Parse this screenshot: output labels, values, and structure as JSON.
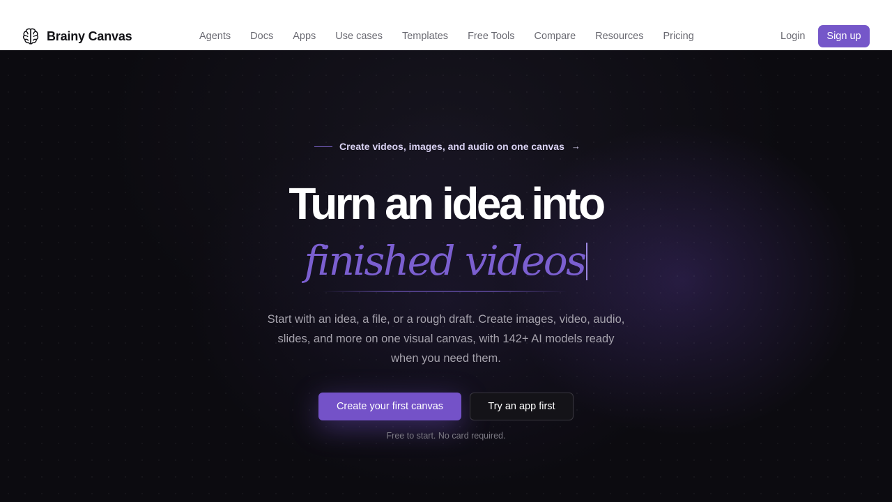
{
  "brand": {
    "name": "Brainy Canvas",
    "logo_icon": "brain-icon"
  },
  "nav": {
    "items": [
      {
        "label": "Agents"
      },
      {
        "label": "Docs"
      },
      {
        "label": "Apps"
      },
      {
        "label": "Use cases"
      },
      {
        "label": "Templates"
      },
      {
        "label": "Free Tools"
      },
      {
        "label": "Compare"
      },
      {
        "label": "Resources"
      },
      {
        "label": "Pricing"
      }
    ],
    "login_label": "Login",
    "signup_label": "Sign up"
  },
  "hero": {
    "eyebrow": "Create videos, images, and audio on one canvas",
    "eyebrow_arrow": "→",
    "headline": "Turn an idea into",
    "headline_accent": "finished videos",
    "subtitle": "Start with an idea, a file, or a rough draft. Create images, video, audio, slides, and more on one visual canvas, with 142+ AI models ready when you need them.",
    "cta_primary": "Create your first canvas",
    "cta_secondary": "Try an app first",
    "note": "Free to start. No card required."
  },
  "colors": {
    "accent": "#7452c8",
    "background": "#0c0b10",
    "header_bg": "#ffffff"
  }
}
